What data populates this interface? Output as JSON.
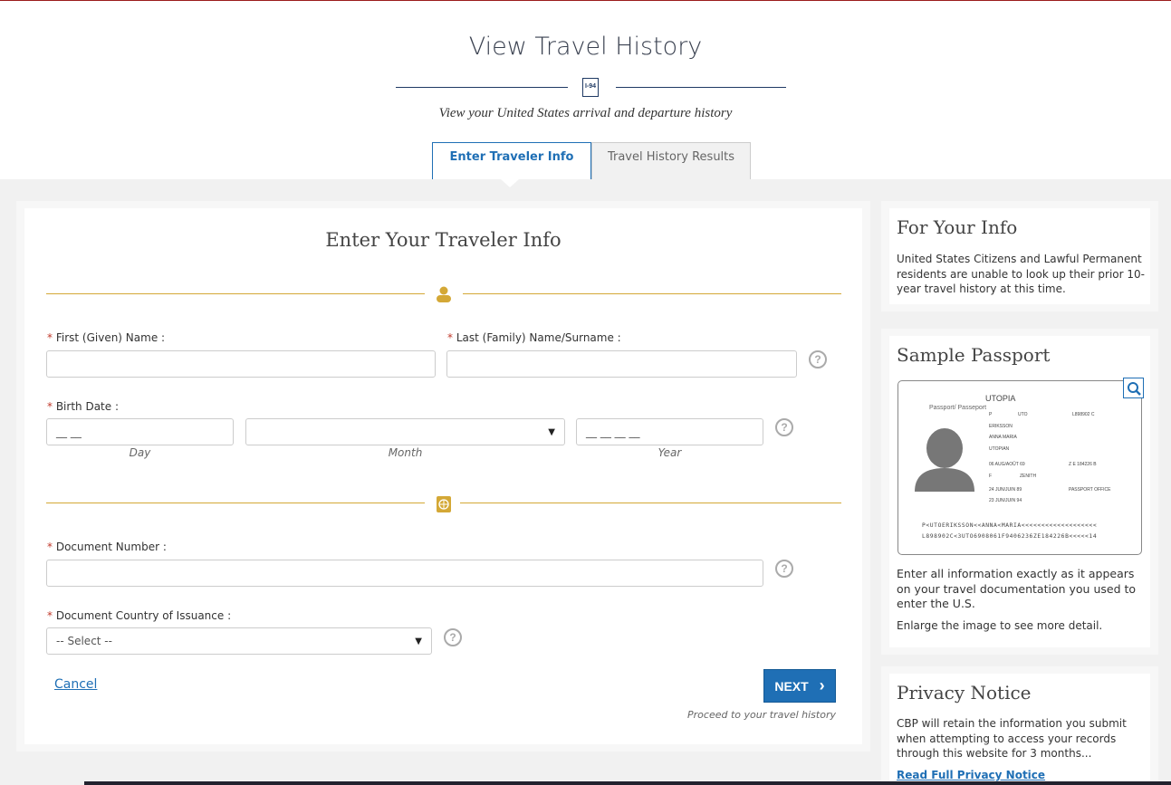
{
  "header": {
    "title": "View Travel History",
    "icon_label": "I-94",
    "subtitle": "View your United States arrival and departure history"
  },
  "tabs": [
    {
      "label": "Enter Traveler Info",
      "active": true
    },
    {
      "label": "Travel History Results",
      "active": false
    }
  ],
  "form": {
    "title": "Enter Your Traveler Info",
    "required_mark": "*",
    "first_name_label": "First (Given) Name :",
    "last_name_label": "Last (Family) Name/Surname :",
    "birth_date_label": "Birth Date :",
    "day_placeholder": "__ __",
    "year_placeholder": "__ __ __ __",
    "day_caption": "Day",
    "month_caption": "Month",
    "year_caption": "Year",
    "doc_number_label": "Document Number :",
    "country_label": "Document Country of Issuance :",
    "country_value": "-- Select --",
    "help": "?",
    "cancel": "Cancel",
    "next": "NEXT",
    "next_caption": "Proceed to your travel history",
    "accent_color": "#d4a836"
  },
  "sidebar": {
    "info_title": "For Your Info",
    "info_text": "United States Citizens and Lawful Permanent residents are unable to look up their prior 10-year travel history at this time.",
    "sample_title": "Sample Passport",
    "sample_text1": "Enter all information exactly as it appears on your travel documentation you used to enter the U.S.",
    "sample_text2": "Enlarge the image to see more detail.",
    "privacy_title": "Privacy Notice",
    "privacy_text": "CBP will retain the information you submit when attempting to access your records through this website for 3 months...",
    "privacy_link": "Read Full Privacy Notice"
  },
  "passport": {
    "country": "UTOPIA",
    "type_label": "Passport/ Passeport",
    "type": "P",
    "code": "UTO",
    "number": "L898902 C",
    "surname": "ERIKSSON",
    "given": "ANNA MARIA",
    "nationality": "UTOPIAN",
    "dob": "06 AUG/AOÛT 69",
    "personal_no": "Z E 184226 B",
    "sex": "F",
    "birthplace": "ZENITH",
    "issue": "24 JUN/JUIN 89",
    "authority": "PASSPORT OFFICE",
    "expiry": "23 JUN/JUIN 94",
    "mrz1": "P<UTOERIKSSON<<ANNA<MARIA<<<<<<<<<<<<<<<<<<<",
    "mrz2": "L898902C<3UTO6908061F9406236ZE184226B<<<<<14"
  }
}
